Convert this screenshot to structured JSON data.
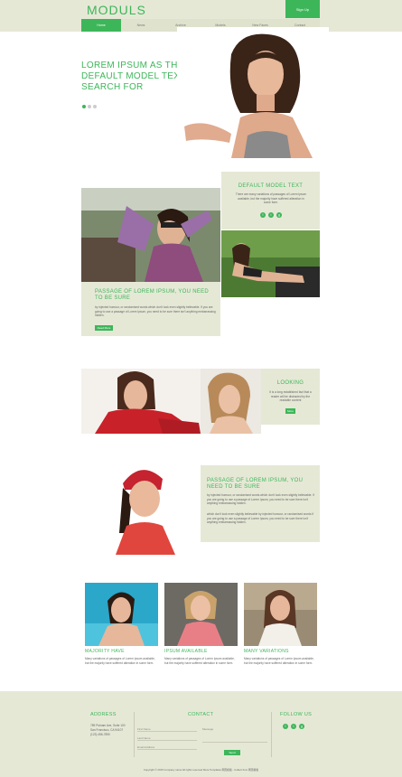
{
  "header": {
    "logo": "MODULS",
    "signup": "Sign Up",
    "nav": [
      {
        "label": "Home",
        "active": true
      },
      {
        "label": "News",
        "active": false
      },
      {
        "label": "Archive",
        "active": false
      },
      {
        "label": "Models",
        "active": false
      },
      {
        "label": "New Faces",
        "active": false
      },
      {
        "label": "Contact",
        "active": false
      }
    ]
  },
  "hero": {
    "title": "LOREM IPSUM AS THEIR DEFAULT MODEL TEXT, AND A SEARCH FOR",
    "slides": 3,
    "active_slide": 1
  },
  "feature1": {
    "title": "Default model text",
    "text": "There are many variations of passages of Lorem Ipsum available, but the majority have suffered alteration in some form."
  },
  "feature2": {
    "title": "Passage of Lorem Ipsum, you need to be sure",
    "text": "by injected humour, or randomised words which don't look even slightly believable. If you are going to use a passage of Lorem Ipsum, you need to be sure there isn't anything embarrassing hidden.",
    "button": "Read More"
  },
  "looking": {
    "title": "Looking",
    "text": "It is a long established fact that a reader will be distracted by the readable content",
    "button": "More"
  },
  "feature3": {
    "title": "Passage of Lorem Ipsum, you need to be sure",
    "text1": "by injected humour, or randomised words which don't look even slightly believable. If you are going to use a passage of Lorem Ipsum, you need to be sure there isn't anything embarrassing hidden.",
    "text2": "which don't look even slightly believable by injected humour, or randomised words If you are going to use a passage of Lorem Ipsum, you need to be sure there isn't anything embarrassing hidden."
  },
  "cards": [
    {
      "title": "Majority have",
      "text": "Many variations of passages of Lorem Ipsum available, but the majority have suffered alteration in some form."
    },
    {
      "title": "Ipsum available",
      "text": "Many variations of passages of Lorem Ipsum available, but the majority have suffered alteration in some form."
    },
    {
      "title": "Many variations",
      "text": "Many variations of passages of Lorem Ipsum available, but the majority have suffered alteration in some form."
    }
  ],
  "footer": {
    "address_title": "Address",
    "address_lines": [
      "789 Putnam Ave, Suite 100",
      "San Francisco, CA 94107",
      "(123) 456-7890"
    ],
    "contact_title": "Contact",
    "name_placeholder": "First Name",
    "last_placeholder": "Last Name",
    "email_placeholder": "Email Address",
    "message_placeholder": "Message",
    "send": "Send",
    "follow_title": "Follow Us",
    "copyright": "Copyright © 2015 Company name All rights reserved More Templates 网页模板 - Collect from 网页模板"
  },
  "colors": {
    "accent": "#3db65a",
    "beige": "#e6e8d6"
  },
  "icons": [
    "facebook-icon",
    "twitter-icon",
    "google-plus-icon"
  ]
}
